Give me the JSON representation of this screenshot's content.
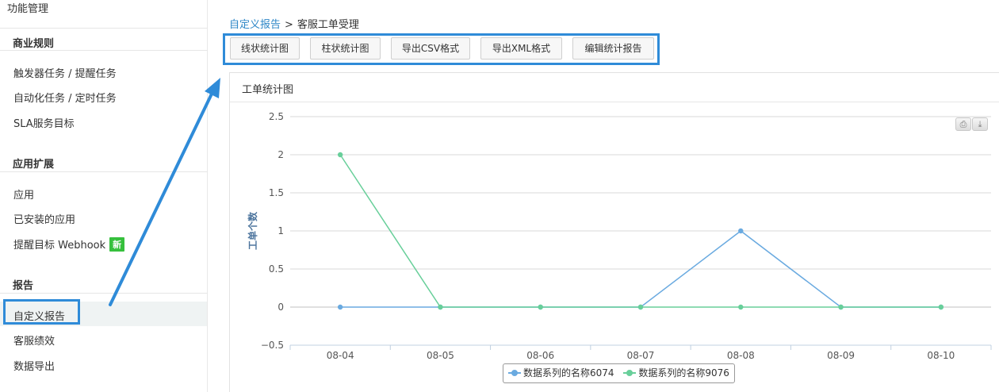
{
  "sidebar": {
    "top_label": "功能管理",
    "sections": [
      {
        "title": "商业规则",
        "items": [
          "触发器任务 / 提醒任务",
          "自动化任务 / 定时任务",
          "SLA服务目标"
        ]
      },
      {
        "title": "应用扩展",
        "items": [
          "应用",
          "已安装的应用",
          "提醒目标 Webhook"
        ]
      },
      {
        "title": "报告",
        "items": [
          "自定义报告",
          "客服绩效",
          "数据导出"
        ]
      }
    ],
    "new_badge": "新",
    "active_item": "自定义报告"
  },
  "breadcrumb": {
    "link": "自定义报告",
    "separator": ">",
    "current": "客服工单受理"
  },
  "toolbar": {
    "buttons": [
      "线状统计图",
      "柱状统计图",
      "导出CSV格式",
      "导出XML格式",
      "编辑统计报告"
    ]
  },
  "panel": {
    "title": "工单统计图"
  },
  "export_icons": [
    "print-icon",
    "download-icon"
  ],
  "colors": {
    "highlight": "#2f8bd8",
    "link": "#2e87c7",
    "series1": "#6aaae0",
    "series2": "#68cf9a",
    "badge": "#36c03d"
  },
  "chart_data": {
    "type": "line",
    "x": [
      "08-04",
      "08-05",
      "08-06",
      "08-07",
      "08-08",
      "08-09",
      "08-10"
    ],
    "ylabel": "工单个数",
    "ylim": [
      -0.5,
      2.5
    ],
    "yticks": [
      2.5,
      2,
      1.5,
      1,
      0.5,
      0,
      -0.5
    ],
    "ytick_labels": [
      "2.5",
      "2",
      "1.5",
      "1",
      "0.5",
      "0",
      "−0.5"
    ],
    "grid": true,
    "legend": "bottom-center",
    "series": [
      {
        "name": "数据系列的名称6074",
        "color": "#6aaae0",
        "values": [
          0,
          0,
          0,
          0,
          1,
          0,
          0
        ]
      },
      {
        "name": "数据系列的名称9076",
        "color": "#68cf9a",
        "values": [
          2,
          0,
          0,
          0,
          0,
          0,
          0
        ]
      }
    ]
  }
}
